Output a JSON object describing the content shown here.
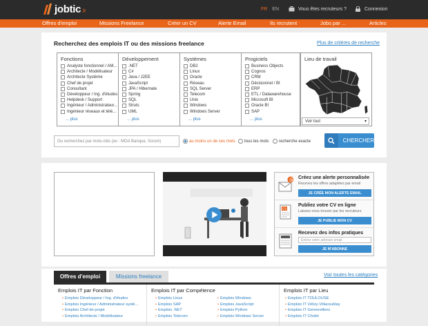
{
  "brand": {
    "name": "jobtic",
    "tld": ".fr",
    "accent": "#e8641b",
    "link": "#2a7ec0",
    "button": "#3a8ed0"
  },
  "header": {
    "lang_active": "FR",
    "lang_other": "EN",
    "recruiter_label": "Vous êtes recruteurs ?",
    "recruiter_icon": "briefcase-icon",
    "connexion_label": "Connexion",
    "connexion_icon": "lock-icon"
  },
  "nav": [
    "Offres d'emploi",
    "Missions Freelance",
    "Créer un CV",
    "Alerte Email",
    "Ils recrutent",
    "Jobs par ...",
    "Articles"
  ],
  "search": {
    "title": "Recherchez des emplois IT ou des missions freelance",
    "more_criteria": "Plus de critères de recherche",
    "columns": [
      {
        "title": "Fonctions",
        "items": [
          "Analyste fonctionnel / AM...",
          "Architecte / Modélisateur",
          "Architecte Système",
          "Chef de projet",
          "Consultant",
          "Développeur / Ing. d'études",
          "Helpdesk / Support",
          "Ingénieur / Administrateur...",
          "Ingénieur réseaux et télé..."
        ],
        "more": "... plus"
      },
      {
        "title": "Développement",
        "items": [
          ".NET",
          "C#",
          "Java / J2EE",
          "JavaScript",
          "JPA / Hibernate",
          "Spring",
          "SQL",
          "Struts",
          "UML"
        ],
        "more": "... plus"
      },
      {
        "title": "Systèmes",
        "items": [
          "DB2",
          "Linux",
          "Oracle",
          "Réseau",
          "SQL Server",
          "Telecom",
          "Unix",
          "Windows",
          "Windows Server"
        ],
        "more": "... plus"
      },
      {
        "title": "Progiciels",
        "items": [
          "Business Objects",
          "Cognos",
          "CRM",
          "Décisionnel / BI",
          "ERP",
          "ETL / Datawarehouse",
          "Microsoft BI",
          "Oracle BI",
          "SAP"
        ],
        "more": "... plus"
      }
    ],
    "map_title": "Lieu de travail",
    "map_select": "Voir tout",
    "keyword_placeholder": "Ou recherchez par mots-clés (ex : MOA Banque, Scrum)",
    "radios": [
      "au moins un de ces mots",
      "tous les mots",
      "recherche exacte"
    ],
    "radio_selected": 0,
    "submit": "CHERCHER"
  },
  "promos": [
    {
      "title": "Créez une alerte personnalisée",
      "sub": "Recevez les offres adaptées par email",
      "button": "JE CRÉE MON ALERTE EMAIL",
      "icon": "email-alert-icon"
    },
    {
      "title": "Publiez votre CV en ligne",
      "sub": "Laissez-vous trouver par les recruteurs",
      "button": "JE PUBLIE MON CV",
      "icon": "cv-icon"
    },
    {
      "title": "Recevez des infos pratiques",
      "input_placeholder": "Entrez votre adresse email",
      "button": "JE M'ABONNE",
      "icon": "newsletter-icon"
    }
  ],
  "tabs": {
    "active": "Offres d'emploi",
    "other": "Missions freelance",
    "all_categories": "Voir toutes les catégories"
  },
  "lists": [
    {
      "title": "Emplois IT par Fonction",
      "items": [
        "Emplois Développeur / Ing. d'études",
        "Emplois Ingénieur / Administrateur systè...",
        "Emplois Chef de projet",
        "Emplois Architecte / Modélisateur"
      ]
    },
    {
      "title": "Emplois IT par Compétence",
      "items": [
        "Emplois Linux",
        "Emplois SAP",
        "Emplois .NET",
        "Emplois Telecom"
      ],
      "items2": [
        "Emplois Windows",
        "Emplois JavaScript",
        "Emplois Python",
        "Emplois Windows Server"
      ]
    },
    {
      "title": "Emplois IT par Lieu",
      "items": [
        "Emplois IT TOULOUSE",
        "Emplois IT Vélizy-Villacoublay",
        "Emplois IT Gennevilliers",
        "Emplois IT Cholet"
      ]
    }
  ]
}
